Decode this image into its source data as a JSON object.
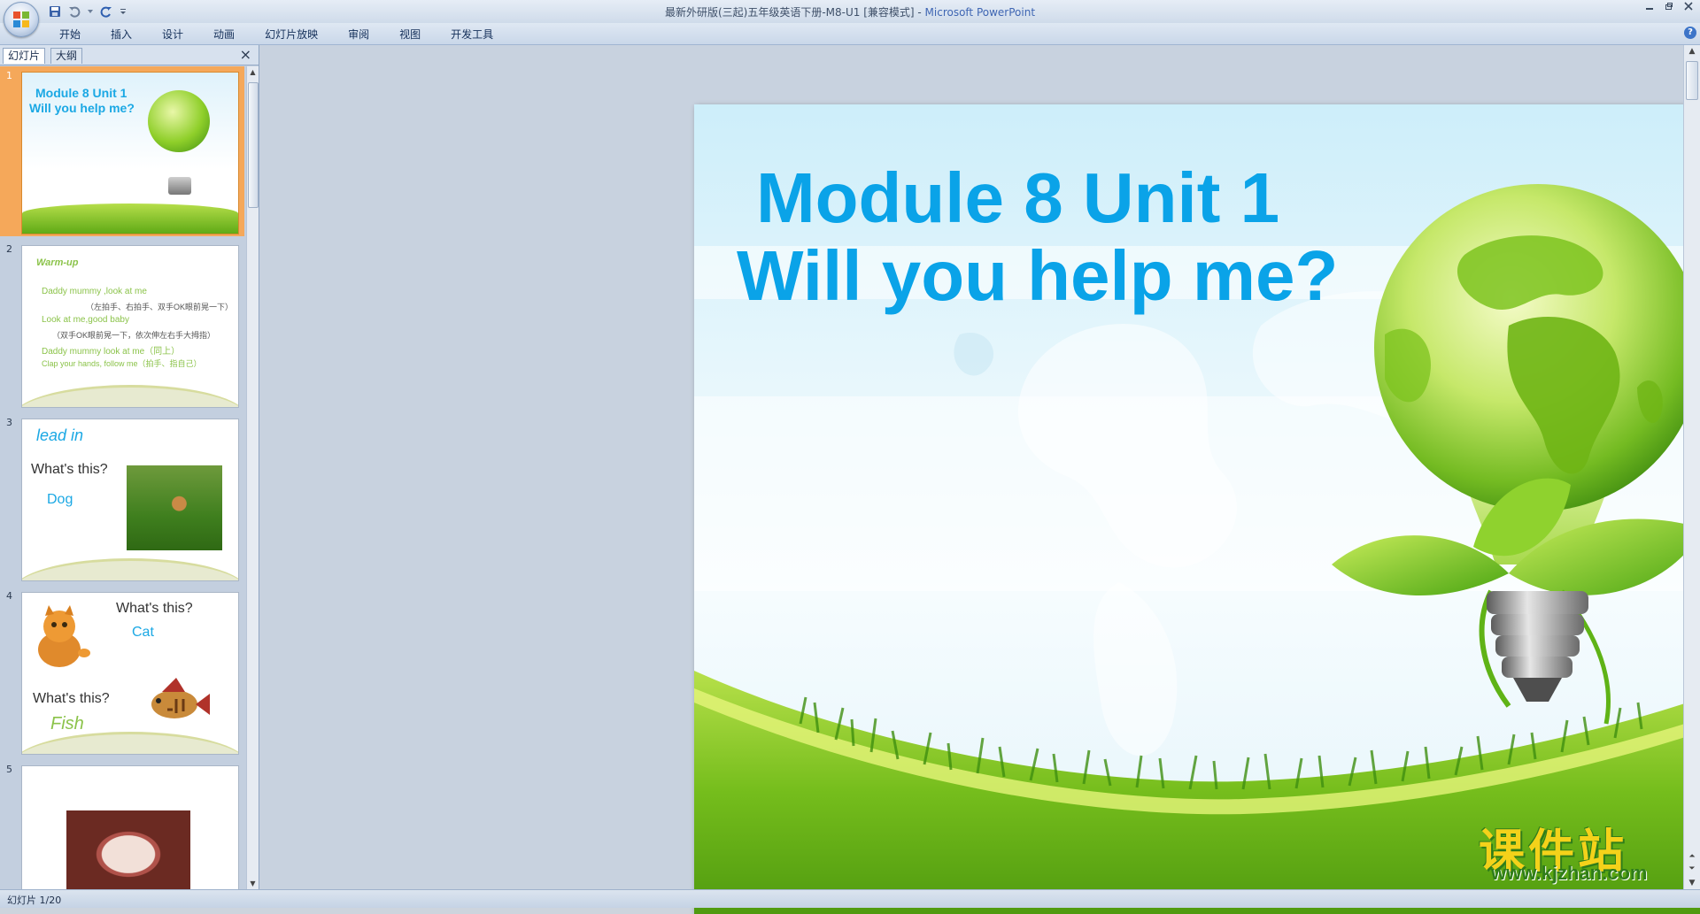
{
  "window": {
    "title_doc": "最新外研版(三起)五年级英语下册-M8-U1 [兼容模式]",
    "title_sep": " - ",
    "title_app": "Microsoft PowerPoint"
  },
  "ribbon": {
    "tabs": [
      "开始",
      "插入",
      "设计",
      "动画",
      "幻灯片放映",
      "审阅",
      "视图",
      "开发工具"
    ]
  },
  "left_pane": {
    "tab_slides": "幻灯片",
    "tab_outline": "大纲",
    "close": "×"
  },
  "thumbnails": {
    "t1": {
      "num": "1",
      "line1": "Module 8   Unit 1",
      "line2": "Will you help me?"
    },
    "t2": {
      "num": "2",
      "title": "Warm-up",
      "lines": [
        "Daddy mummy ,look at me",
        "（左拍手、右拍手、双手OK眼前晃一下）",
        "Look at me,good baby",
        "（双手OK眼前晃一下，依次伸左右手大拇指）",
        "Daddy mummy look at me（同上）",
        "Clap your hands, follow me（拍手、指自己）"
      ]
    },
    "t3": {
      "num": "3",
      "title": "lead in",
      "question": "What's this?",
      "answer": "Dog"
    },
    "t4": {
      "num": "4",
      "q1": "What's this?",
      "a1": "Cat",
      "q2": "What's this?",
      "a2": "Fish"
    },
    "t5": {
      "num": "5"
    }
  },
  "slide": {
    "title_line1": "Module 8   Unit 1",
    "title_line2": "Will you  help me?"
  },
  "watermark": {
    "cn": "课件站",
    "url": "www.kjzhan.com"
  },
  "status": {
    "slide_count": "幻灯片 1/20"
  },
  "colors": {
    "title_blue": "#0aa3e8",
    "grass_green": "#6fb81c",
    "selected_thumb": "#f5a85a"
  }
}
